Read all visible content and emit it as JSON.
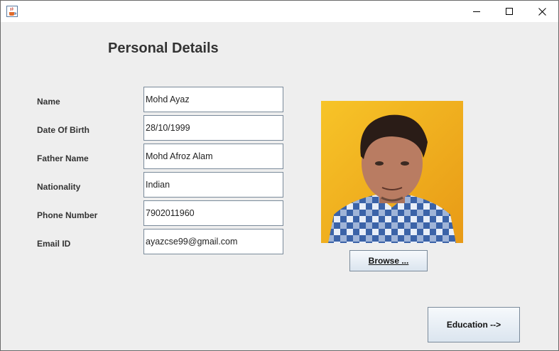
{
  "window": {
    "controls": {
      "minimize_icon": "minimize-icon",
      "maximize_icon": "maximize-icon",
      "close_icon": "close-icon"
    },
    "app_icon": "java-cup-icon"
  },
  "form": {
    "heading": "Personal Details",
    "fields": [
      {
        "label": "Name",
        "value": "Mohd Ayaz"
      },
      {
        "label": "Date Of Birth",
        "value": "28/10/1999"
      },
      {
        "label": "Father Name",
        "value": "Mohd Afroz Alam"
      },
      {
        "label": "Nationality",
        "value": "Indian"
      },
      {
        "label": "Phone Number",
        "value": "7902011960"
      },
      {
        "label": "Email ID",
        "value": "ayazcse99@gmail.com"
      }
    ]
  },
  "photo": {
    "browse_label": "Browse ...",
    "background_color": "#f3b21f"
  },
  "navigation": {
    "education_label": "Education -->"
  }
}
